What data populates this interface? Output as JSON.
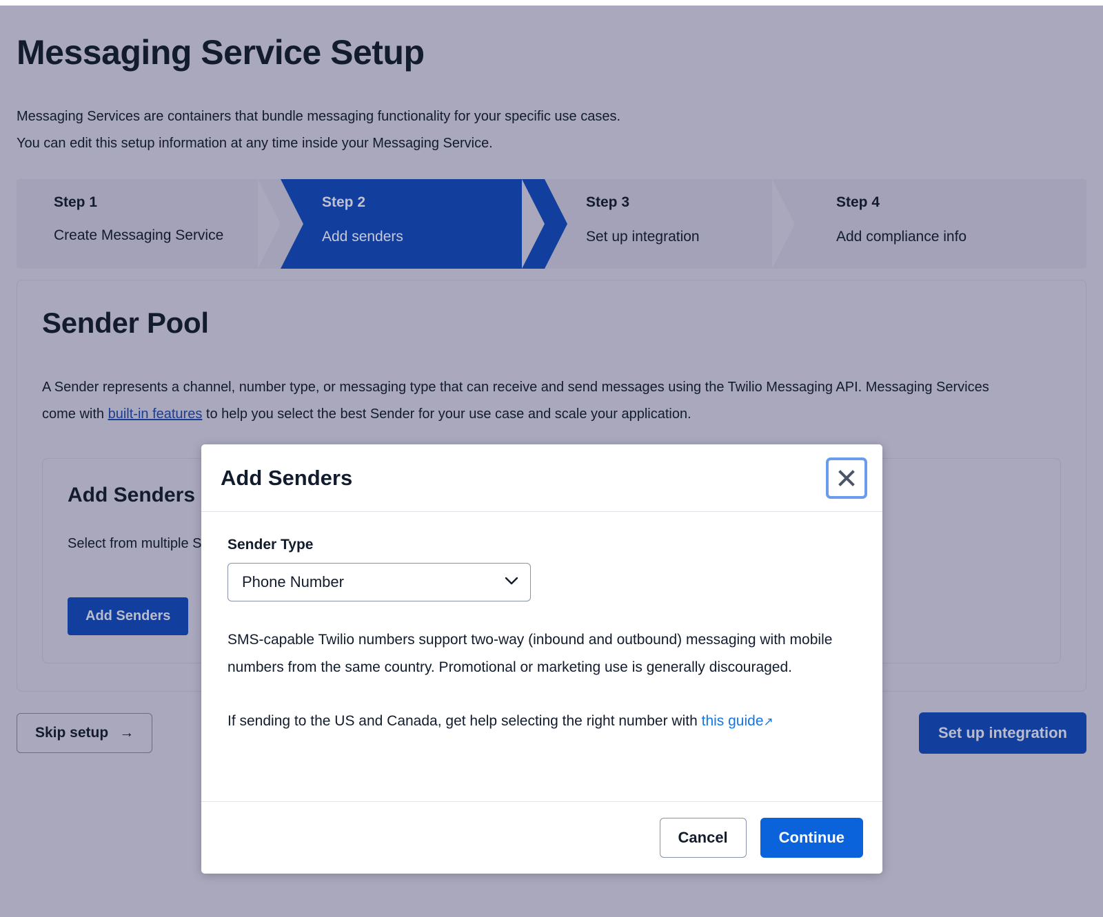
{
  "page": {
    "title": "Messaging Service Setup",
    "subtitle_line1": "Messaging Services are containers that bundle messaging functionality for your specific use cases.",
    "subtitle_line2": "You can edit this setup information at any time inside your Messaging Service."
  },
  "steps": [
    {
      "number": "Step 1",
      "label": "Create Messaging Service",
      "active": false
    },
    {
      "number": "Step 2",
      "label": "Add senders",
      "active": true
    },
    {
      "number": "Step 3",
      "label": "Set up integration",
      "active": false
    },
    {
      "number": "Step 4",
      "label": "Add compliance info",
      "active": false
    }
  ],
  "sender_pool": {
    "heading": "Sender Pool",
    "desc_part1": "A Sender represents a channel, number type, or messaging type that can receive and send messages using the Twilio Messaging API. Messaging Services come with ",
    "desc_link": "built-in features",
    "desc_part2": " to help you select the best Sender for your use case and scale your application.",
    "card": {
      "title": "Add Senders",
      "description": "Select from multiple Sender types based on your application or use case.",
      "button": "Add Senders"
    }
  },
  "footer": {
    "skip_label": "Skip setup",
    "skip_arrow": "→",
    "setup_label": "Set up integration"
  },
  "modal": {
    "title": "Add Senders",
    "close_icon": "close-icon",
    "field_label": "Sender Type",
    "select_value": "Phone Number",
    "select_options": [
      "Phone Number"
    ],
    "paragraph1": "SMS-capable Twilio numbers support two-way (inbound and outbound) messaging with mobile numbers from the same country. Promotional or marketing use is generally discouraged.",
    "paragraph2_before": "If sending to the US and Canada, get help selecting the right number with ",
    "paragraph2_link": "this guide",
    "paragraph2_link_icon": "↗",
    "cancel_label": "Cancel",
    "continue_label": "Continue"
  },
  "colors": {
    "brand_blue": "#0b63db",
    "dimmed_blue": "#123f9e",
    "page_bg": "#a9a8bd",
    "text_dark": "#121c2d",
    "link_blue": "#1676e3",
    "focus_ring": "#6a9bec"
  }
}
